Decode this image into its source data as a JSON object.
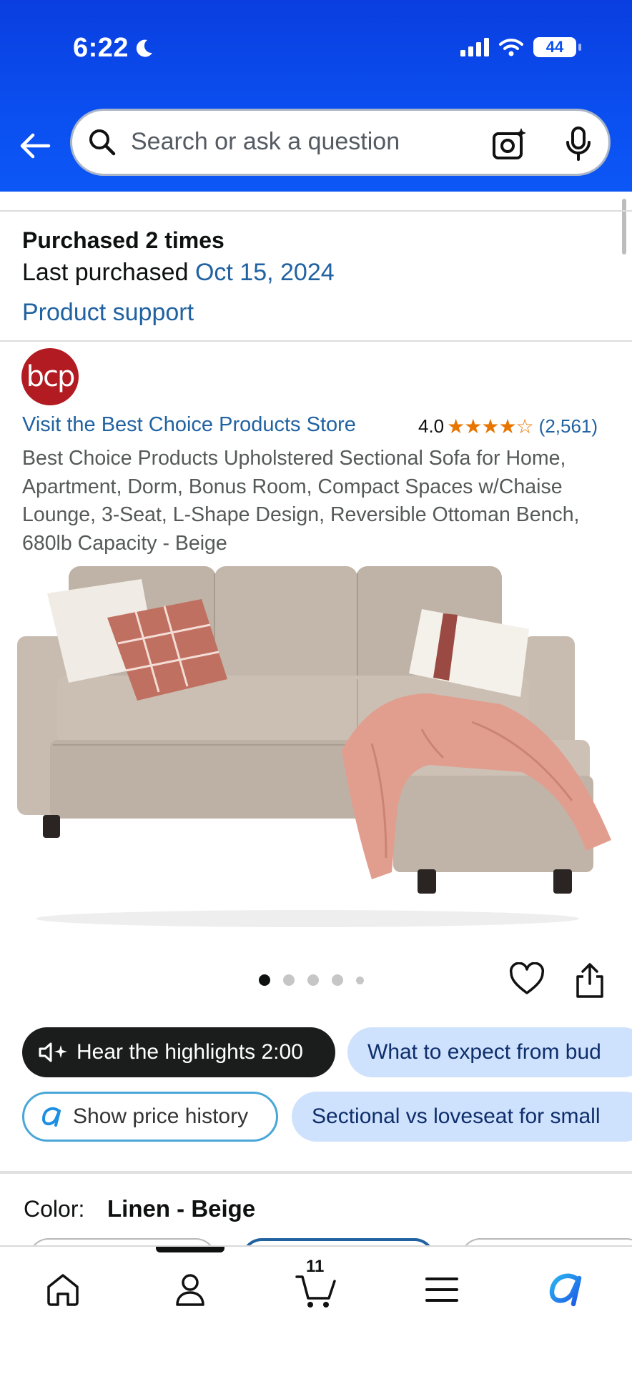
{
  "status": {
    "time": "6:22",
    "battery": "44"
  },
  "search": {
    "placeholder": "Search or ask a question"
  },
  "purchase": {
    "count_text": "Purchased 2 times",
    "last_label": "Last purchased",
    "last_date": "Oct 15, 2024",
    "support_link": "Product support"
  },
  "brand": {
    "logo_text": "bcp",
    "store_link": "Visit the Best Choice Products Store",
    "rating": "4.0",
    "stars": "★★★★☆",
    "review_count": "(2,561)"
  },
  "product": {
    "title": "Best Choice Products Upholstered Sectional Sofa for Home, Apartment, Dorm, Bonus Room, Compact Spaces w/Chaise Lounge, 3-Seat, L-Shape Design, Reversible Ottoman Bench, 680lb Capacity - Beige"
  },
  "chips": {
    "highlights": "Hear the highlights 2:00",
    "expect": "What to expect from bud",
    "price_history": "Show price history",
    "sectional_vs": "Sectional vs loveseat for small"
  },
  "color": {
    "label": "Color:",
    "value": "Linen - Beige"
  },
  "nav": {
    "cart_count": "11"
  },
  "colors": {
    "header_blue": "#0b4ff0",
    "link_blue": "#2162a1",
    "star_orange": "#e77600",
    "chip_blue": "#cfe2fd"
  }
}
